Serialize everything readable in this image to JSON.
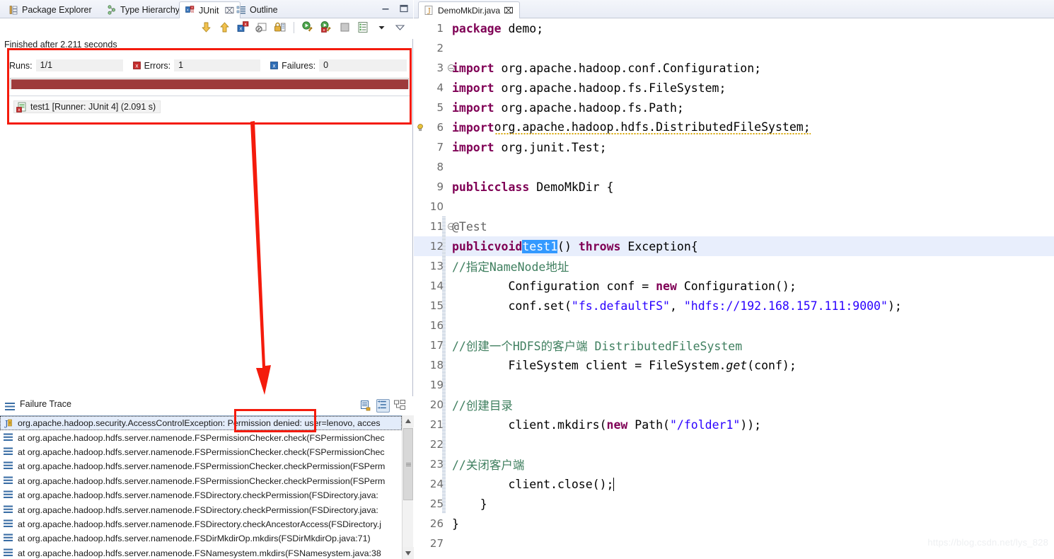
{
  "views": {
    "tabs": [
      {
        "label": "Package Explorer",
        "icon": "package-explorer-icon",
        "active": false,
        "closable": false
      },
      {
        "label": "Type Hierarchy",
        "icon": "type-hierarchy-icon",
        "active": false,
        "closable": false
      },
      {
        "label": "JUnit",
        "icon": "junit-icon",
        "active": true,
        "closable": true,
        "close": "⌧"
      },
      {
        "label": "Outline",
        "icon": "outline-icon",
        "active": false,
        "closable": false
      }
    ],
    "window_buttons": [
      {
        "name": "minimize-button",
        "glyph": "—"
      },
      {
        "name": "maximize-button",
        "glyph": "❐"
      }
    ],
    "toolbar": [
      {
        "name": "next-failure-icon",
        "title": "Next Failed Test"
      },
      {
        "name": "previous-failure-icon",
        "title": "Previous Failed Test"
      },
      {
        "name": "show-failures-only-icon",
        "title": "Show Failures Only"
      },
      {
        "name": "show-ignored-icon",
        "title": "Show Tests in Hierarchy"
      },
      {
        "name": "lock-scroll-icon",
        "title": "Scroll Lock"
      },
      {
        "name": "rerun-test-icon",
        "title": "Rerun Test"
      },
      {
        "name": "rerun-failed-icon",
        "title": "Rerun Test - Failures First"
      },
      {
        "name": "stop-icon",
        "title": "Stop JUnit Test Run"
      },
      {
        "name": "test-run-history-icon",
        "title": "Test Run History"
      },
      {
        "name": "view-menu-chevron-icon",
        "title": "View Menu"
      },
      {
        "name": "minimize-view-icon",
        "title": "Minimize"
      }
    ]
  },
  "junit": {
    "status_line": "Finished after 2.211 seconds",
    "counters": [
      {
        "name": "runs",
        "label": "Runs:",
        "value": "1/1",
        "icon": null
      },
      {
        "name": "errors",
        "label": "Errors:",
        "value": "1",
        "icon": "error-marker-icon"
      },
      {
        "name": "failures",
        "label": "Failures:",
        "value": "0",
        "icon": "failure-marker-icon"
      }
    ],
    "progress": {
      "percent": 100,
      "color": "#9e3b3b",
      "state": "failed"
    },
    "tree": [
      {
        "label": "test1 [Runner: JUnit 4] (2.091 s)",
        "icon": "test-error-icon"
      }
    ]
  },
  "failure_trace": {
    "title": "Failure Trace",
    "header_icons": [
      {
        "name": "copy-trace-icon"
      },
      {
        "name": "filter-stack-trace-icon",
        "pressed": true
      },
      {
        "name": "compare-result-icon"
      }
    ],
    "rows": [
      {
        "icon": "exception-icon",
        "text": "org.apache.hadoop.security.AccessControlException: Permission denied: user=lenovo, acces",
        "selected": true
      },
      {
        "icon": "stackframe-icon",
        "text": "at org.apache.hadoop.hdfs.server.namenode.FSPermissionChecker.check(FSPermissionChec",
        "selected": false
      },
      {
        "icon": "stackframe-icon",
        "text": "at org.apache.hadoop.hdfs.server.namenode.FSPermissionChecker.check(FSPermissionChec",
        "selected": false
      },
      {
        "icon": "stackframe-icon",
        "text": "at org.apache.hadoop.hdfs.server.namenode.FSPermissionChecker.checkPermission(FSPerm",
        "selected": false
      },
      {
        "icon": "stackframe-icon",
        "text": "at org.apache.hadoop.hdfs.server.namenode.FSPermissionChecker.checkPermission(FSPerm",
        "selected": false
      },
      {
        "icon": "stackframe-icon",
        "text": "at org.apache.hadoop.hdfs.server.namenode.FSDirectory.checkPermission(FSDirectory.java:",
        "selected": false
      },
      {
        "icon": "stackframe-icon",
        "text": "at org.apache.hadoop.hdfs.server.namenode.FSDirectory.checkPermission(FSDirectory.java:",
        "selected": false
      },
      {
        "icon": "stackframe-icon",
        "text": "at org.apache.hadoop.hdfs.server.namenode.FSDirectory.checkAncestorAccess(FSDirectory.j",
        "selected": false
      },
      {
        "icon": "stackframe-icon",
        "text": "at org.apache.hadoop.hdfs.server.namenode.FSDirMkdirOp.mkdirs(FSDirMkdirOp.java:71)",
        "selected": false
      },
      {
        "icon": "stackframe-icon",
        "text": "at org.apache.hadoop.hdfs.server.namenode.FSNamesystem.mkdirs(FSNamesystem.java:38",
        "selected": false
      }
    ]
  },
  "editor": {
    "tab": {
      "label": "DemoMkDir.java",
      "icon": "java-file-icon",
      "close": "⌧",
      "active": true
    },
    "cursor_line": 12,
    "selected_token": "test1",
    "lines": [
      {
        "n": 1,
        "fold": false,
        "marker": null,
        "indent": 0
      },
      {
        "n": 2,
        "fold": false,
        "marker": null,
        "indent": 0
      },
      {
        "n": 3,
        "fold": true,
        "marker": null,
        "indent": 0
      },
      {
        "n": 4,
        "fold": false,
        "marker": null,
        "indent": 0
      },
      {
        "n": 5,
        "fold": false,
        "marker": null,
        "indent": 0
      },
      {
        "n": 6,
        "fold": false,
        "marker": "warning-icon",
        "indent": 0
      },
      {
        "n": 7,
        "fold": false,
        "marker": null,
        "indent": 0
      },
      {
        "n": 8,
        "fold": false,
        "marker": null,
        "indent": 0
      },
      {
        "n": 9,
        "fold": false,
        "marker": null,
        "indent": 0
      },
      {
        "n": 10,
        "fold": false,
        "marker": null,
        "indent": 0
      },
      {
        "n": 11,
        "fold": true,
        "marker": null,
        "indent": 1
      },
      {
        "n": 12,
        "fold": false,
        "marker": null,
        "indent": 1
      },
      {
        "n": 13,
        "fold": false,
        "marker": null,
        "indent": 2
      },
      {
        "n": 14,
        "fold": false,
        "marker": null,
        "indent": 2
      },
      {
        "n": 15,
        "fold": false,
        "marker": null,
        "indent": 2
      },
      {
        "n": 16,
        "fold": false,
        "marker": null,
        "indent": 2
      },
      {
        "n": 17,
        "fold": false,
        "marker": null,
        "indent": 2
      },
      {
        "n": 18,
        "fold": false,
        "marker": null,
        "indent": 2
      },
      {
        "n": 19,
        "fold": false,
        "marker": null,
        "indent": 2
      },
      {
        "n": 20,
        "fold": false,
        "marker": null,
        "indent": 2
      },
      {
        "n": 21,
        "fold": false,
        "marker": null,
        "indent": 2
      },
      {
        "n": 22,
        "fold": false,
        "marker": null,
        "indent": 2
      },
      {
        "n": 23,
        "fold": false,
        "marker": null,
        "indent": 2
      },
      {
        "n": 24,
        "fold": false,
        "marker": null,
        "indent": 2
      },
      {
        "n": 25,
        "fold": false,
        "marker": null,
        "indent": 1
      },
      {
        "n": 26,
        "fold": false,
        "marker": null,
        "indent": 0
      },
      {
        "n": 27,
        "fold": false,
        "marker": null,
        "indent": 0
      }
    ],
    "source": [
      "package demo;",
      "",
      "import org.apache.hadoop.conf.Configuration;",
      "import org.apache.hadoop.fs.FileSystem;",
      "import org.apache.hadoop.fs.Path;",
      "import org.apache.hadoop.hdfs.DistributedFileSystem;",
      "import org.junit.Test;",
      "",
      "public class DemoMkDir {",
      "",
      "    @Test",
      "    public void test1() throws Exception{",
      "        //指定NameNode地址",
      "        Configuration conf = new Configuration();",
      "        conf.set(\"fs.defaultFS\", \"hdfs://192.168.157.111:9000\");",
      "",
      "        //创建一个HDFS的客户端 DistributedFileSystem",
      "        FileSystem client = FileSystem.get(conf);",
      "",
      "        //创建目录",
      "        client.mkdirs(new Path(\"/folder1\"));",
      "",
      "        //关闭客户端",
      "        client.close();",
      "    }",
      "}",
      ""
    ]
  },
  "annotations": {
    "color": "#f41b0c",
    "box_results": {
      "label": "junit-results-highlight"
    },
    "box_permission": {
      "label": "permission-denied-highlight"
    },
    "arrow": {
      "label": "pointer-arrow"
    }
  },
  "watermark": "https://blog.csdn.net/lys_828"
}
